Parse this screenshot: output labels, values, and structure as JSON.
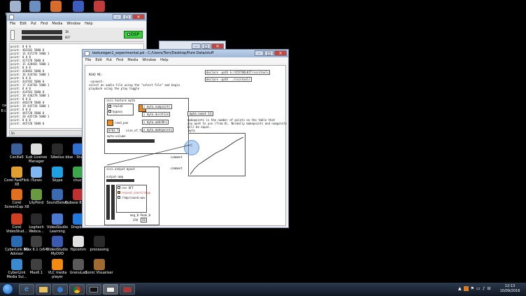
{
  "desktop": {
    "icons_top": [
      {
        "label": "Recycle Bin",
        "color": "#9fb4cc"
      },
      {
        "label": "Pd",
        "color": "#6a8fc0"
      },
      {
        "label": "Mozilla",
        "color": "#d96b2b"
      },
      {
        "label": "MAX",
        "color": "#3a5dbf"
      },
      {
        "label": "soundflower",
        "color": "#c23b3b"
      }
    ],
    "icons_grid": [
      {
        "label": "Cecilia5",
        "color": "#3b5f9a"
      },
      {
        "label": "iLok License Manager",
        "color": "#dcdcdc"
      },
      {
        "label": "Sibelius",
        "color": "#2a2a2a"
      },
      {
        "label": "blue - Shortcut",
        "color": "#2f6fd1"
      },
      {
        "label": "Corel FastFlick X8",
        "color": "#e0a030"
      },
      {
        "label": "iTunes",
        "color": "#7fb8f0"
      },
      {
        "label": "Skype",
        "color": "#1fa0e0"
      },
      {
        "label": "chuck",
        "color": "#3aa84a"
      },
      {
        "label": "Corel ScreenCap X8",
        "color": "#e07020"
      },
      {
        "label": "LilyPond",
        "color": "#6a9a40"
      },
      {
        "label": "SoundSeism",
        "color": "#3a6ab0"
      },
      {
        "label": "Cubase 8 64bit",
        "color": "#c03030"
      },
      {
        "label": "Corel VideoStud...",
        "color": "#d04020"
      },
      {
        "label": "Logitech Webca...",
        "color": "#2a2a2a"
      },
      {
        "label": "VideoStudio Learning",
        "color": "#4a7ad0"
      },
      {
        "label": "Dropbox",
        "color": "#1f7ae0"
      },
      {
        "label": "CyberLink BD Advisor",
        "color": "#2a6ab0"
      },
      {
        "label": "Max 6.1 (x64)",
        "color": "#404040"
      },
      {
        "label": "VideoStudio MyDVD",
        "color": "#3a5ab0"
      },
      {
        "label": "ftpcomm",
        "color": "#e0e0e0"
      },
      {
        "label": "processing",
        "color": "#2a2a2a"
      },
      {
        "label": "CyberLink Media Sui...",
        "color": "#3a8ad0"
      },
      {
        "label": "Max6.1",
        "color": "#404040"
      },
      {
        "label": "VLC media player",
        "color": "#f08a10"
      },
      {
        "label": "GranuLab",
        "color": "#5a5a5a"
      },
      {
        "label": "Sonic Visualiser",
        "color": "#a06a30"
      }
    ],
    "left_icons_partial": [
      "cat",
      "E-l...",
      "Fi..."
    ]
  },
  "pd_main": {
    "menu": [
      "File",
      "Edit",
      "Put",
      "Find",
      "Media",
      "Window",
      "Help"
    ],
    "audio_in_label": "IN",
    "audio_out_label": "OUT",
    "dsp_label": "DSP",
    "console_lines": [
      "point: 0 0 0",
      "point: 403203 5000 0",
      "point: 14 437278 5000 1",
      "point: 0 0 0",
      "point: 417378 5000 0",
      "point: 15 428483 5000 1",
      "point: 0 0 0",
      "point: 428483 5000 0",
      "point: 16 434703 5000 1",
      "point: 0 0 0",
      "point: 434703 5000 0",
      "point: 17 434703 5000 1",
      "point: 0 0 0",
      "point: 434703 5000 0",
      "point: 18 436278 5000 1",
      "point: 0 0 0",
      "point: 446278 5000 0",
      "point: 19 445728 5000 1",
      "point: 0 0 0",
      "point: 445728 5000 0",
      "point: 20 445728 5000 1",
      "point: 0 0 0",
      "point: 445728 5000 0"
    ],
    "status": "Sh"
  },
  "patch_window": {
    "title": "texturegen1_experimental.pd  - C:/Users/Tom/Desktop/Pure Data/stuff",
    "menu": [
      "File",
      "Edit",
      "Put",
      "Find",
      "Media",
      "Window",
      "Help"
    ],
    "comments": {
      "read_me": "READ ME:",
      "instructions": "-connect-\nselect an audio file using the \"select file\" and begin\nplayback using the play toggle",
      "makepoints_note": "makepoints is the number of points on the table that\nyou want to use (from 0). Normally makepoints and numpoints\nwill be equal.",
      "comment1": "comment",
      "comment2": "comment"
    },
    "declares": [
      "declare -path G:/S55TOOLKIT/sscstools",
      "declare -path ../sscstools"
    ],
    "objects": {
      "texture_obj": "sscs.texture myta",
      "rewind": "rewind",
      "bypass": "bypass",
      "rand_pan": "rand_pan",
      "sizeoffile": "size_of_file",
      "file_num": "0703.7",
      "myta_volume": "myta-volume",
      "send_numpoints": "s myta.numpoints",
      "send_duration": "s myta.duration",
      "send_addr": "s myta.addrNrs",
      "send_makepoints": "s myta.makepoints",
      "myta_const": "myta const 11",
      "myta_array": "myta",
      "output_obj": "sscs.output myout",
      "output_amp": "output-amp",
      "rec_off": "rec OFF",
      "record_start_stop": "record_start/stop",
      "sound_wav": "/tmp/sound.wav",
      "msg_rate": "msg_0 Peak_0",
      "cpu_label": "CPU",
      "cpu_value": "58"
    }
  },
  "taskbar": {
    "time": "12:13",
    "date": "10/09/2016",
    "apps": [
      "start",
      "ie",
      "explorer",
      "media",
      "chrome",
      "terminal",
      "pd",
      "pd2"
    ]
  }
}
